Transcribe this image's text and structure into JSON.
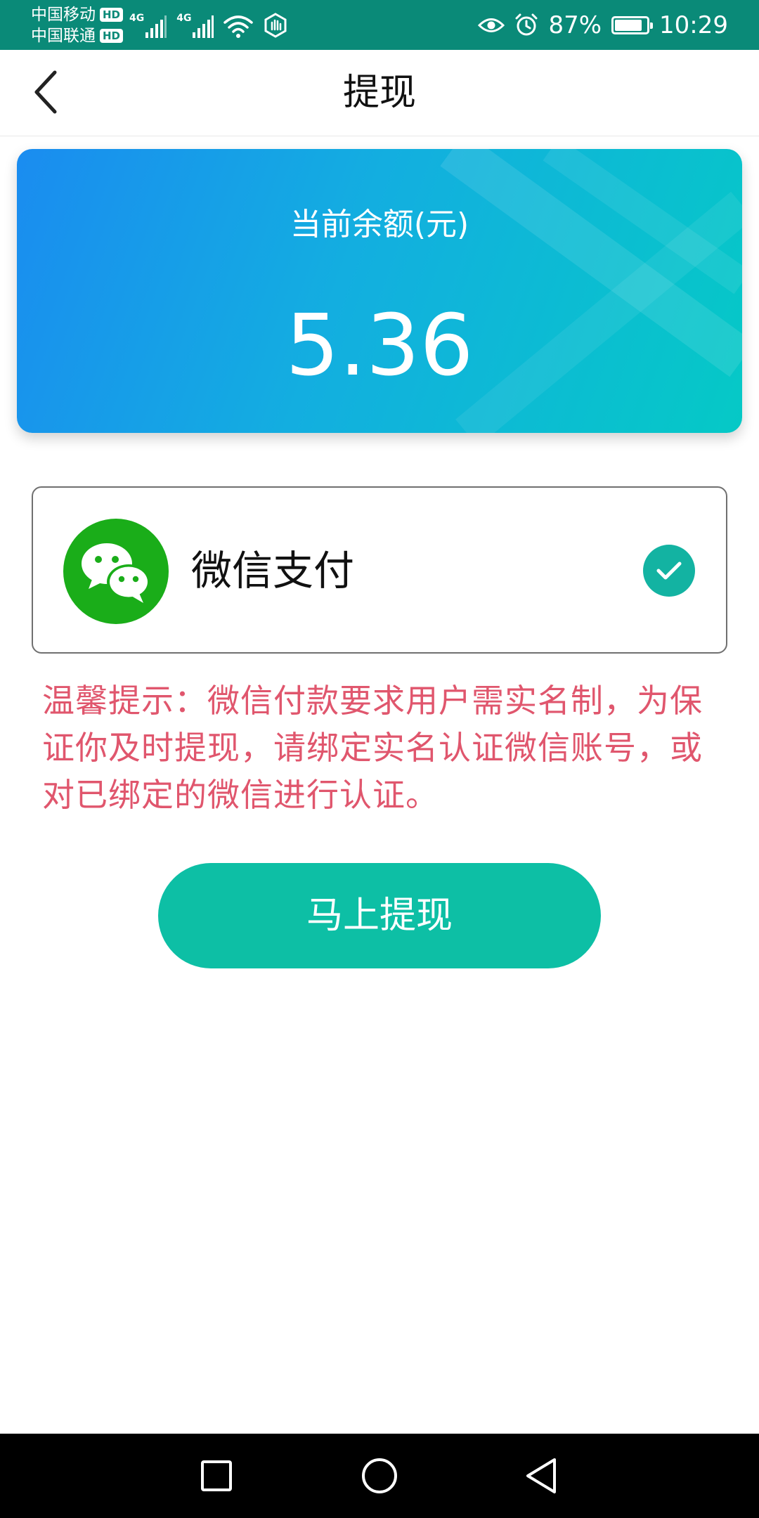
{
  "status_bar": {
    "carrier_1": "中国移动",
    "carrier_2": "中国联通",
    "hd_badge": "HD",
    "network_1": "4G",
    "network_2": "4G",
    "battery_percent": "87%",
    "battery_level": 0.87,
    "time": "10:29",
    "icons": [
      "signal-icon",
      "wifi-icon",
      "hand-icon",
      "eye-icon",
      "alarm-icon",
      "battery-icon"
    ]
  },
  "nav": {
    "title": "提现",
    "back_icon": "chevron-left-icon"
  },
  "balance": {
    "label": "当前余额(元)",
    "amount": "5.36"
  },
  "payment": {
    "method_label": "微信支付",
    "logo_icon": "wechat-icon",
    "selected": true,
    "selected_icon": "check-icon"
  },
  "tip": {
    "text": "温馨提示：微信付款要求用户需实名制，为保证你及时提现，请绑定实名认证微信账号，或对已绑定的微信进行认证。"
  },
  "action": {
    "withdraw_label": "马上提现"
  },
  "system_nav": {
    "icons": [
      "square-icon",
      "circle-icon",
      "triangle-back-icon"
    ]
  },
  "colors": {
    "status_bar": "#0a8a78",
    "card_gradient_start": "#1a8cf0",
    "card_gradient_end": "#05c9c6",
    "wechat_green": "#1aad19",
    "check_teal": "#13b3a2",
    "tip_red": "#e0566d",
    "button_teal": "#0dbfa5"
  }
}
